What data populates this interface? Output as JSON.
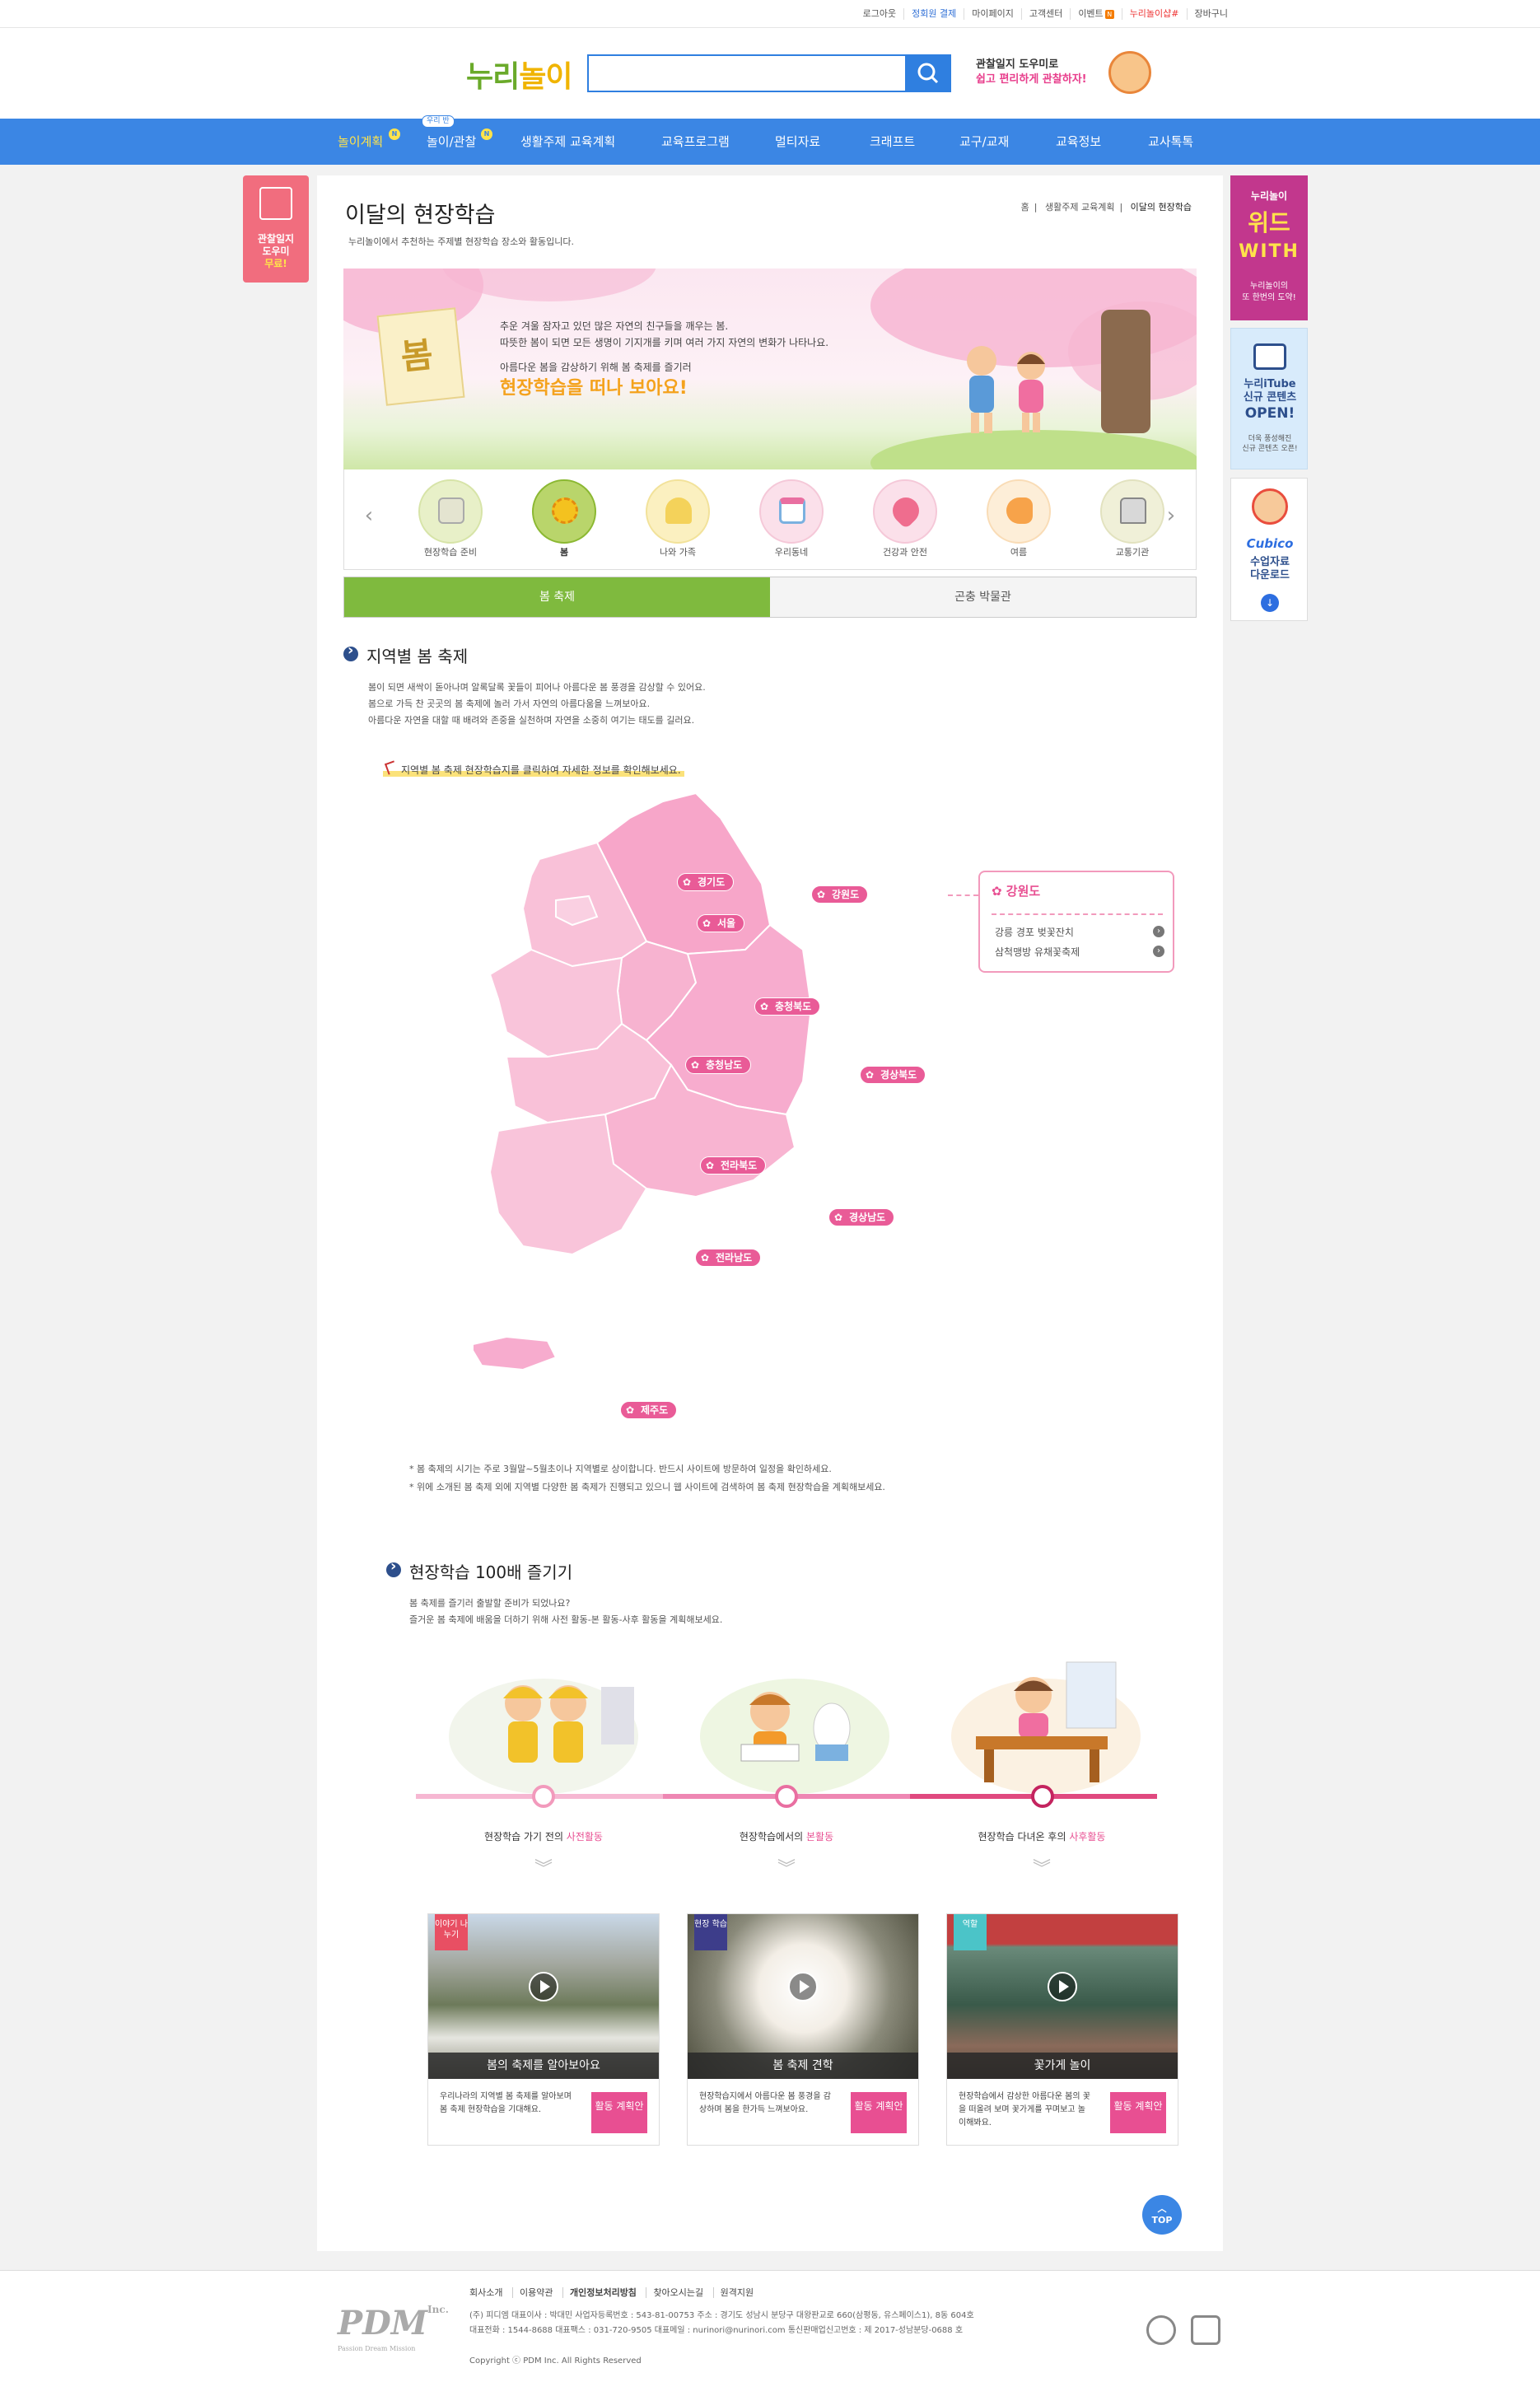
{
  "util": {
    "links": [
      "로그아웃",
      "정회원 결제",
      "마이페이지",
      "고객센터",
      "이벤트",
      "누리놀이샵#",
      "장바구니"
    ]
  },
  "header": {
    "logo_a": "누리",
    "logo_b": "놀이",
    "search_placeholder": "",
    "promo_line1": "관찰일지 도우미로",
    "promo_line2": "쉽고 편리하게 관찰하자!"
  },
  "gnb": {
    "items": [
      "놀이계획",
      "놀이/관찰",
      "생활주제 교육계획",
      "교육프로그램",
      "멀티자료",
      "크래프트",
      "교구/교재",
      "교육정보",
      "교사톡톡"
    ],
    "pill": "우리 반",
    "badge": "N"
  },
  "left_banner": {
    "line1": "관찰일지",
    "line2": "도우미",
    "line3": "무료!"
  },
  "page": {
    "title": "이달의 현장학습",
    "subtitle": "누리놀이에서 추천하는 주제별 현장학습 장소와 활동입니다.",
    "breadcrumb": [
      "홈",
      "생활주제 교육계획",
      "이달의 현장학습"
    ]
  },
  "banner": {
    "note": "봄",
    "line1": "추운 겨울 잠자고 있던 많은 자연의 친구들을 깨우는 봄.",
    "line2": "따뜻한 봄이 되면 모든 생명이 기지개를 키며 여러 가지 자연의 변화가 나타나요.",
    "line3": "아름다운 봄을 감상하기 위해 봄 축제를 즐기러",
    "big": "현장학습을 떠나 보아요!"
  },
  "themes": [
    {
      "label": "현장학습 준비",
      "icon": "book-icon",
      "active": false
    },
    {
      "label": "봄",
      "icon": "flower-icon",
      "active": true
    },
    {
      "label": "나와 가족",
      "icon": "family-icon",
      "active": false
    },
    {
      "label": "우리동네",
      "icon": "store-icon",
      "active": false
    },
    {
      "label": "건강과 안전",
      "icon": "heart-icon",
      "active": false
    },
    {
      "label": "여름",
      "icon": "fish-icon",
      "active": false
    },
    {
      "label": "교통기관",
      "icon": "bus-icon",
      "active": false
    }
  ],
  "tabs": [
    "봄 축제",
    "곤충 박물관"
  ],
  "section1": {
    "title": "지역별 봄 축제",
    "p1": "봄이 되면 새싹이 돋아나며 알록달록 꽃들이 피어나 아름다운 봄 풍경을 감상할 수 있어요.",
    "p2": "봄으로 가득 찬 곳곳의 봄 축제에 놀러 가서 자연의 아름다움을 느껴보아요.",
    "p3": "아름다운 자연을 대할 때 배려와 존중을 실천하며 자연을 소중히 여기는 태도를 길러요.",
    "map_note": "지역별 봄 축제 현장학습지를 클릭하여 자세한 정보를 확인해보세요.",
    "regions": [
      "경기도",
      "서울",
      "강원도",
      "충청북도",
      "충청남도",
      "경상북도",
      "전라북도",
      "경상남도",
      "전라남도",
      "제주도"
    ],
    "popup": {
      "title": "강원도",
      "items": [
        "강릉 경포 벚꽃잔치",
        "삼척맹방 유채꽃축제"
      ]
    },
    "note1": "* 봄 축제의 시기는 주로 3월말~5월초이나 지역별로 상이합니다. 반드시 사이트에 방문하여 일정을 확인하세요.",
    "note2": "* 위에 소개된 봄 축제 외에 지역별 다양한 봄 축제가 진행되고 있으니 웹 사이트에 검색하여 봄 축제 현장학습을 계획해보세요."
  },
  "section2": {
    "title": "현장학습 100배 즐기기",
    "p1": "봄 축제를 즐기러 출발할 준비가 되었나요?",
    "p2": "즐거운 봄 축제에 배움을 더하기 위해 사전 활동-본 활동-사후 활동을 계획해보세요.",
    "steps": [
      {
        "pre": "현장학습 가기 전의 ",
        "hl": "사전활동"
      },
      {
        "pre": "현장학습에서의 ",
        "hl": "본활동"
      },
      {
        "pre": "현장학습 다녀온 후의 ",
        "hl": "사후활동"
      }
    ],
    "cards": [
      {
        "tag": "이야기 나누기",
        "caption": "봄의 축제를 알아보아요",
        "desc": "우리나라의 지역별 봄 축제를 알아보며 봄 축제 현장학습을 기대해요.",
        "button": "활동 계획안"
      },
      {
        "tag": "현장 학습",
        "caption": "봄 축제 견학",
        "desc": "현장학습지에서 아름다운 봄 풍경을 감상하며 봄을 한가득 느껴보아요.",
        "button": "활동 계획안"
      },
      {
        "tag": "역할",
        "caption": "꽃가게 놀이",
        "desc": "현장학습에서 감상한 아름다운 봄의 꽃을 떠올려 보며 꽃가게를 꾸며보고 놀이해봐요.",
        "button": "활동 계획안"
      }
    ]
  },
  "top_button": "TOP",
  "right_banners": {
    "b1": {
      "line1": "누리놀이",
      "line2": "위드",
      "line3": "WITH",
      "line4": "누리놀이의",
      "line5": "또 한번의 도약!"
    },
    "b2": {
      "line1": "누리iTube",
      "line2": "신규 콘텐츠",
      "line3": "OPEN!",
      "line4": "더욱 풍성해진",
      "line5": "신규 콘텐츠 오픈!"
    },
    "b3": {
      "line1": "Cubico",
      "line2": "수업자료",
      "line3": "다운로드"
    }
  },
  "footer": {
    "links": [
      "회사소개",
      "이용약관",
      "개인정보처리방침",
      "찾아오시는길",
      "원격지원"
    ],
    "info1": "(주) 피디엠 대표이사 : 박대민 사업자등록번호 : 543-81-00753 주소 : 경기도 성남시 분당구 대왕판교로 660(삼평동, 유스페이스1), 8동 604호",
    "info2": "대표전화 : 1544-8688 대표팩스 : 031-720-9505 대표메일 : nurinori@nurinori.com 통신판매업신고번호 : 제 2017-성남분당-0688 호",
    "copyright": "Copyright ⓒ PDM Inc. All Rights Reserved",
    "logo": "PDM",
    "logo_suffix": "Inc.",
    "logo_tagline": "Passion Dream Mission"
  },
  "colors": {
    "brand_green": "#6aaa2a",
    "nav_blue": "#3b86e4",
    "pink": "#e84f92",
    "tab_green": "#7fba3e"
  }
}
